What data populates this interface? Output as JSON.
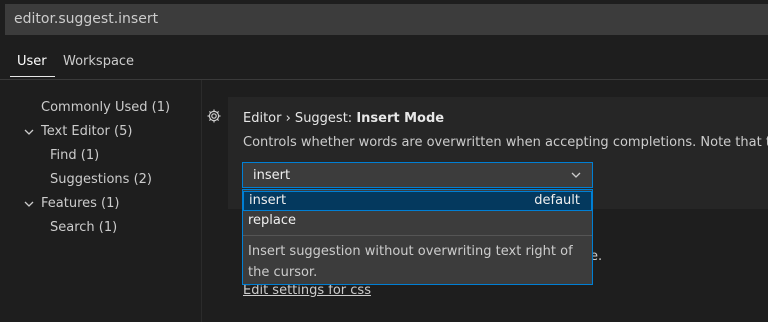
{
  "search": {
    "value": "editor.suggest.insert"
  },
  "tabs": [
    {
      "label": "User"
    },
    {
      "label": "Workspace"
    }
  ],
  "toc": [
    {
      "label": "Commonly Used (1)"
    },
    {
      "label": "Text Editor (5)"
    },
    {
      "label": "Find (1)"
    },
    {
      "label": "Suggestions (2)"
    },
    {
      "label": "Features (1)"
    },
    {
      "label": "Search (1)"
    }
  ],
  "setting": {
    "category": "Editor › Suggest: ",
    "name": "Insert Mode",
    "description": "Controls whether words are overwritten when accepting completions. Note that this",
    "current_value": "insert",
    "behind_text": "e.",
    "edit_link": "Edit settings for css"
  },
  "dropdown": {
    "options": [
      {
        "label": "insert",
        "badge": "default"
      },
      {
        "label": "replace"
      }
    ],
    "description": "Insert suggestion without overwriting text right of the cursor."
  },
  "colors": {
    "accent": "#007fd4",
    "selected_bg": "#04395e"
  },
  "icons": {
    "gear": "gear-icon",
    "chevron_down": "chevron-down-icon"
  }
}
